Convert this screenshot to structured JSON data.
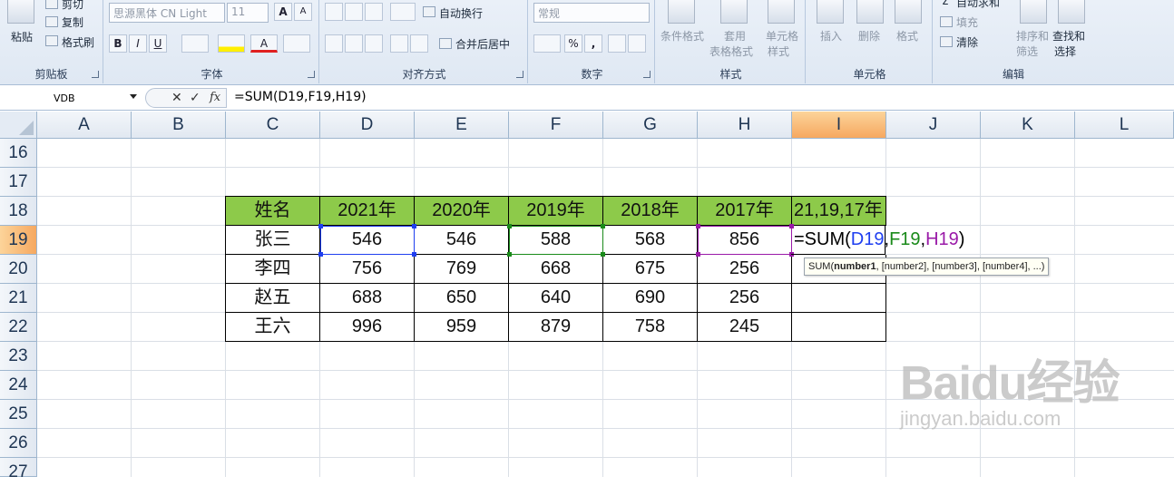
{
  "ribbon": {
    "clipboard": {
      "cut": "剪切",
      "copy": "复制",
      "format_painter": "格式刷",
      "paste": "粘贴",
      "label": "剪贴板"
    },
    "font": {
      "font_name": "思源黑体 CN Light",
      "font_size": "11",
      "bold": "B",
      "italic": "I",
      "underline": "U",
      "grow": "A",
      "shrink": "A",
      "font_color": "A",
      "label": "字体"
    },
    "alignment": {
      "wrap_text": "自动换行",
      "merge_center": "合并后居中",
      "label": "对齐方式"
    },
    "number": {
      "format": "常规",
      "percent": "%",
      "comma": ",",
      "label": "数字"
    },
    "styles": {
      "conditional": "条件格式",
      "table_format_1": "套用",
      "table_format_2": "表格格式",
      "cell_style_1": "单元格",
      "cell_style_2": "样式",
      "label": "样式"
    },
    "cells": {
      "insert": "插入",
      "delete": "删除",
      "format": "格式",
      "label": "单元格"
    },
    "editing": {
      "autosum": "自动求和",
      "fill": "填充",
      "clear": "清除",
      "sort_1": "排序和",
      "sort_2": "筛选",
      "find_1": "查找和",
      "find_2": "选择",
      "label": "编辑"
    }
  },
  "formula_bar": {
    "name_box": "VDB",
    "cancel": "✕",
    "enter": "✓",
    "fx": "fx",
    "formula": "=SUM(D19,F19,H19)"
  },
  "columns": [
    "A",
    "B",
    "C",
    "D",
    "E",
    "F",
    "G",
    "H",
    "I",
    "J",
    "K",
    "L"
  ],
  "rows": [
    "16",
    "17",
    "18",
    "19",
    "20",
    "21",
    "22",
    "23",
    "24",
    "25",
    "26",
    "27"
  ],
  "table": {
    "headers": [
      "姓名",
      "2021年",
      "2020年",
      "2019年",
      "2018年",
      "2017年",
      "21,19,17年"
    ],
    "rows": [
      [
        "张三",
        "546",
        "546",
        "588",
        "568",
        "856"
      ],
      [
        "李四",
        "756",
        "769",
        "668",
        "675",
        "256"
      ],
      [
        "赵五",
        "688",
        "650",
        "640",
        "690",
        "256"
      ],
      [
        "王六",
        "996",
        "959",
        "879",
        "758",
        "245"
      ]
    ]
  },
  "edit_cell": {
    "eq": "=SUM(",
    "ref1": "D19",
    "c1": ",",
    "ref2": "F19",
    "c2": ",",
    "ref3": "H19",
    "close": ")"
  },
  "tooltip": {
    "fn": "SUM(",
    "arg1": "number1",
    "rest": ", [number2], [number3], [number4], ...)"
  },
  "watermark": {
    "logo": "Baidu经验",
    "url": "jingyan.baidu.com"
  },
  "colors": {
    "header_fill": "#8dca4a",
    "ref_blue": "#1f3ff0",
    "ref_green": "#1a8a1a",
    "ref_purple": "#9a1aa8",
    "selected_header": "#f6a860"
  }
}
